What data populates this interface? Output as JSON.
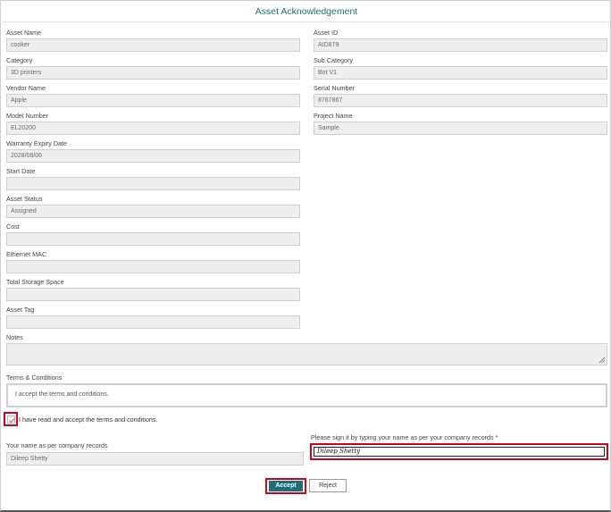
{
  "form": {
    "title": "Asset Acknowledgement",
    "fields_left": [
      {
        "label": "Asset Name",
        "value": "cooker"
      },
      {
        "label": "Category",
        "value": "3D printers"
      },
      {
        "label": "Vendor Name",
        "value": "Apple"
      },
      {
        "label": "Model Number",
        "value": "EL20200"
      },
      {
        "label": "Warranty Expiry Date",
        "value": "2028/08/06"
      },
      {
        "label": "Start Date",
        "value": ""
      },
      {
        "label": "Asset Status",
        "value": "Assigned"
      },
      {
        "label": "Cost",
        "value": ""
      },
      {
        "label": "Ethernet MAC",
        "value": ""
      },
      {
        "label": "Total Storage Space",
        "value": ""
      },
      {
        "label": "Asset Tag",
        "value": ""
      }
    ],
    "fields_right": [
      {
        "label": "Asset ID",
        "value": "AID879"
      },
      {
        "label": "Sub Category",
        "value": "Bot V1"
      },
      {
        "label": "Serial Number",
        "value": "8767867"
      },
      {
        "label": "Project Name",
        "value": "Sample"
      }
    ],
    "notes": {
      "label": "Notes",
      "value": ""
    },
    "terms": {
      "label": "Terms & Conditions",
      "value": "I accept the terms and conditions."
    },
    "accept_checkbox": {
      "label": "I have read and accept the terms and conditions.",
      "checked": true
    },
    "company_name": {
      "label": "Your name as per company records",
      "value": "Dileep Shetty"
    },
    "signature": {
      "label": "Please sign it by typing your name as per your company records *",
      "value": "Dileep Shetty"
    },
    "buttons": {
      "accept": "Accept",
      "reject": "Reject"
    },
    "colors": {
      "accent": "#1e6e7a",
      "highlight": "#d0021b"
    }
  }
}
